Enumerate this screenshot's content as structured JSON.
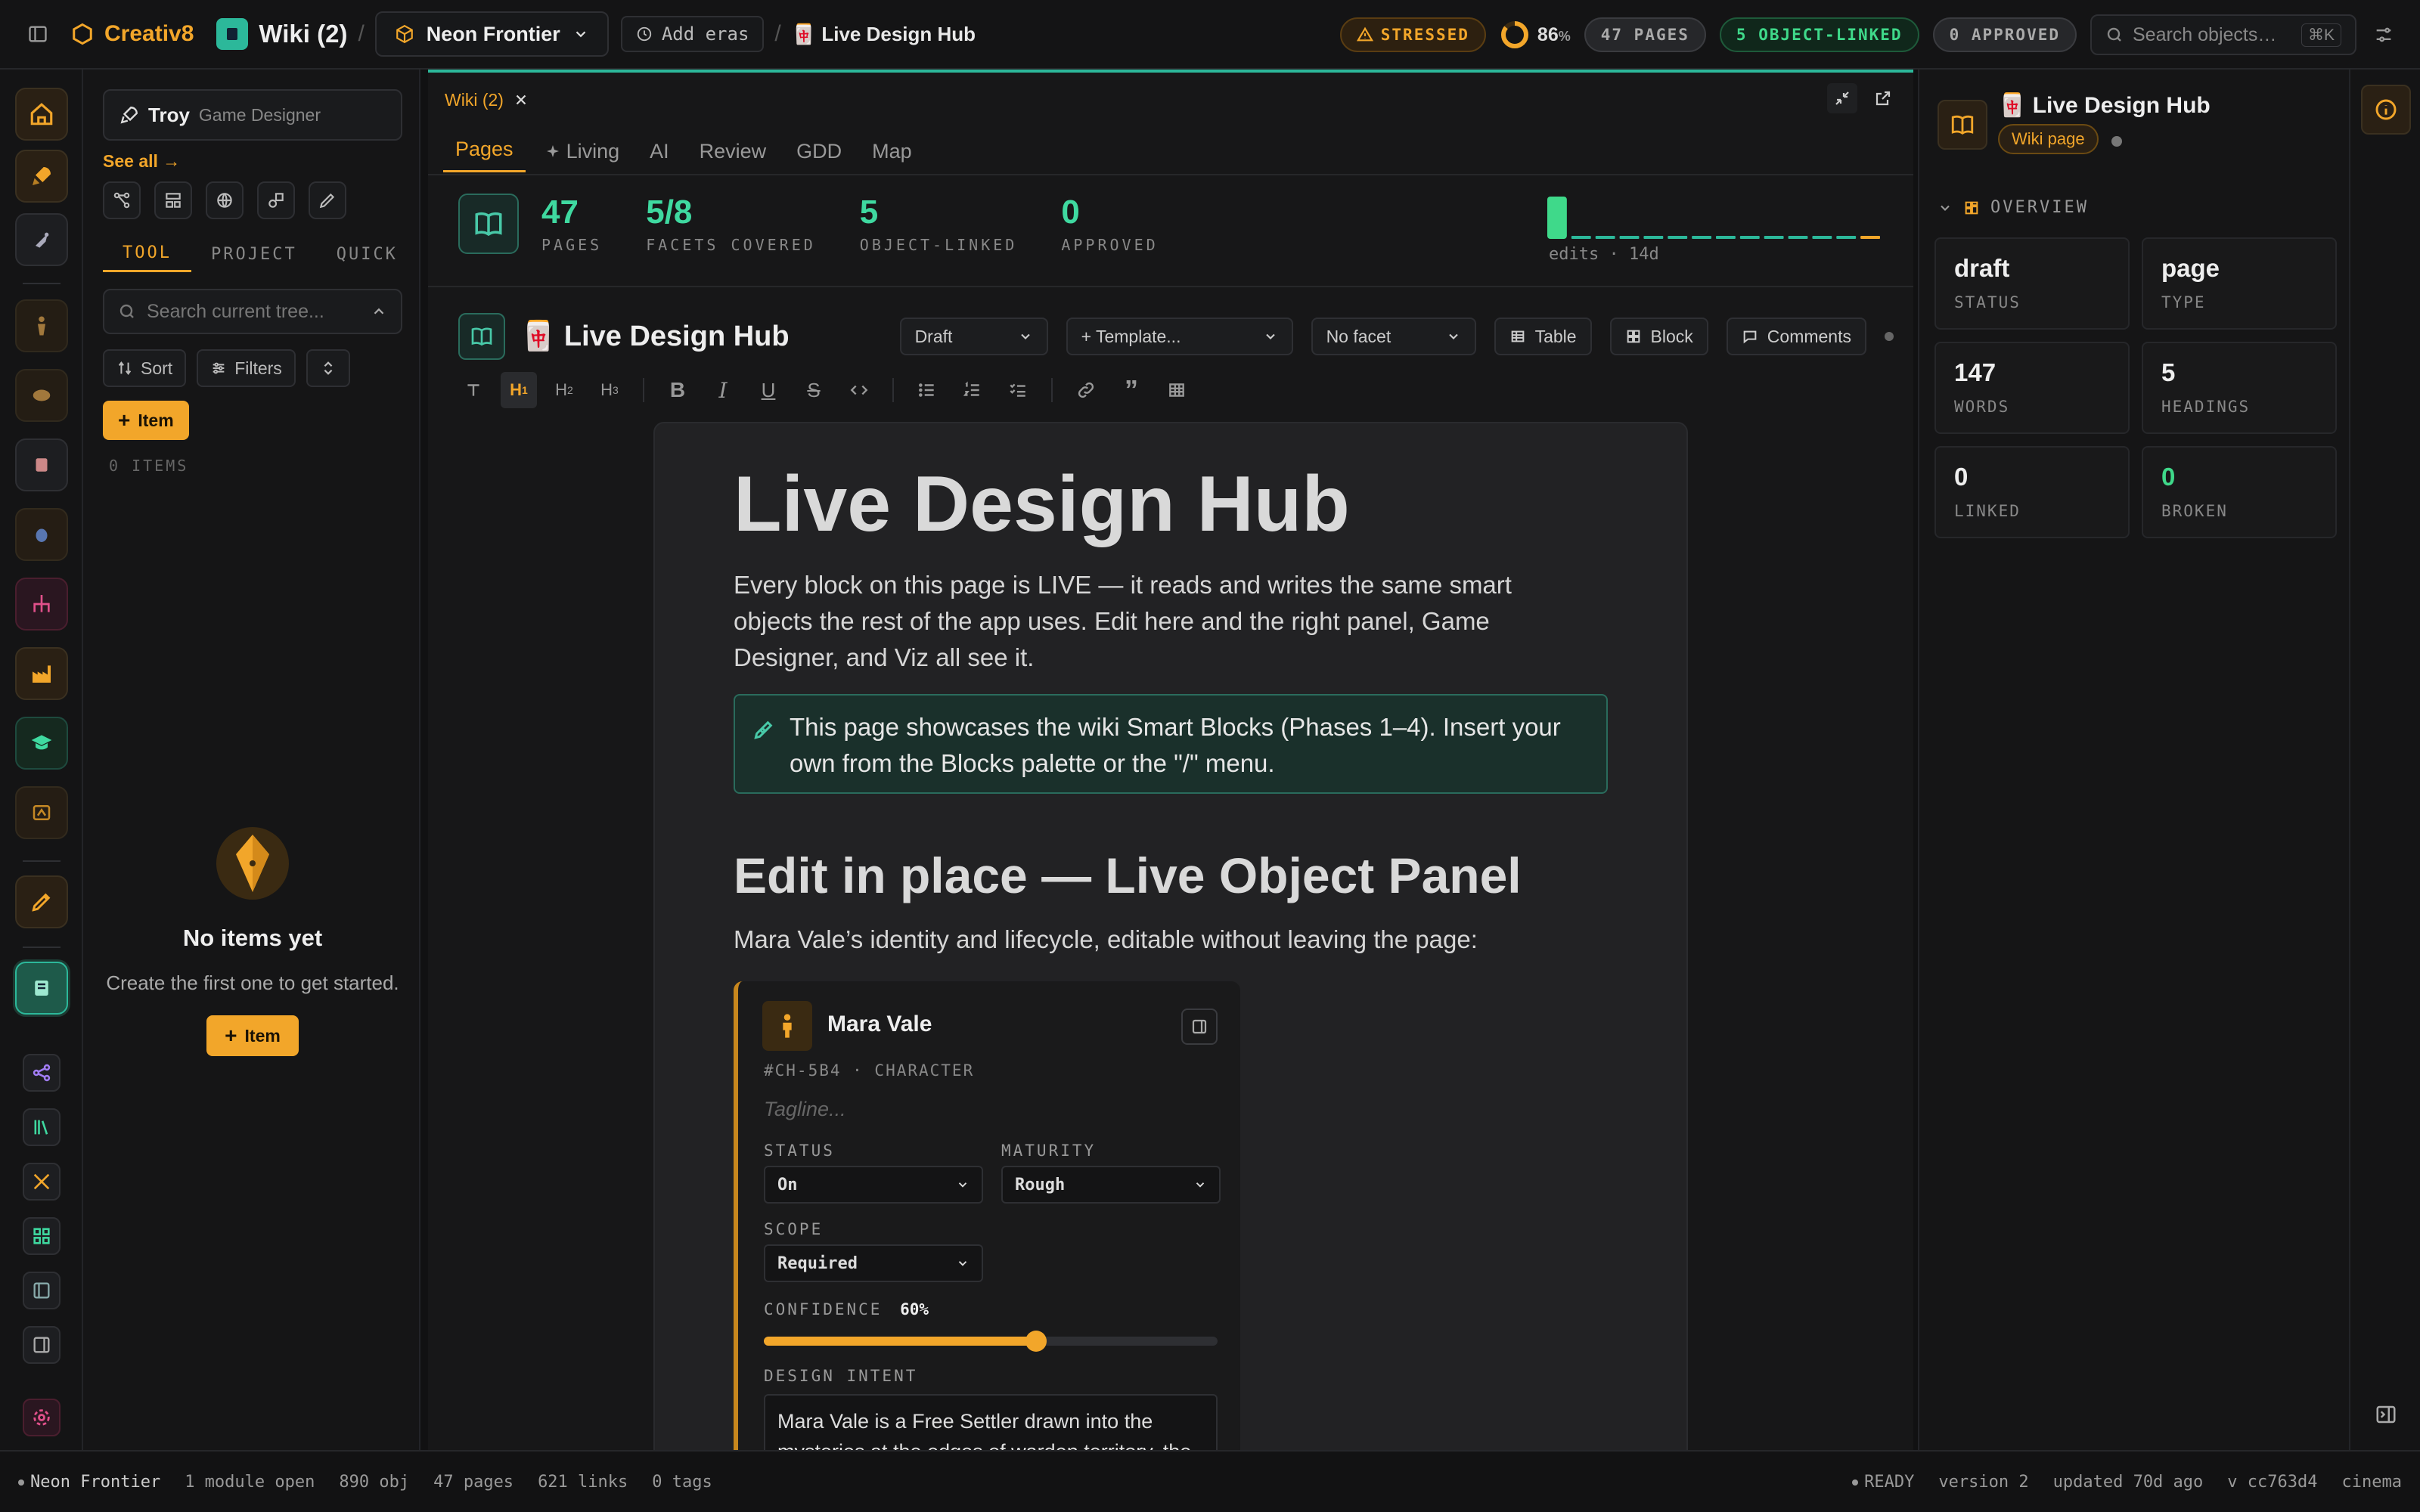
{
  "topbar": {
    "brand": "Creativ8",
    "module_title": "Wiki (2)",
    "project_label": "Neon Frontier",
    "add_eras": "Add eras",
    "crumb_title": "🀄 Live Design Hub",
    "stressed": "STRESSED",
    "ring_value": "86",
    "ring_unit": "%",
    "pages_pill": "47 PAGES",
    "linked_pill": "5 OBJECT-LINKED",
    "approved_pill": "0 APPROVED",
    "search_placeholder": "Search objects…",
    "search_shortcut": "⌘K"
  },
  "sidebar": {
    "user_name": "Troy",
    "user_role": "Game Designer",
    "see_all": "See all →",
    "tabs": [
      "TOOL",
      "PROJECT",
      "QUICK"
    ],
    "search_placeholder": "Search current tree...",
    "sort": "Sort",
    "filters": "Filters",
    "item_button": "Item",
    "items_count": "0 ITEMS",
    "empty_title": "No items yet",
    "empty_sub": "Create the first one to get started.",
    "empty_button": "Item"
  },
  "main": {
    "tab_label": "Wiki (2)",
    "nav_tabs": [
      "Pages",
      "Living",
      "AI",
      "Review",
      "GDD",
      "Map"
    ],
    "stats": [
      {
        "value": "47",
        "label": "PAGES"
      },
      {
        "value": "5/8",
        "label": "FACETS COVERED"
      },
      {
        "value": "5",
        "label": "OBJECT-LINKED"
      },
      {
        "value": "0",
        "label": "APPROVED"
      }
    ],
    "spark_caption": "edits · 14d",
    "doc_title": "🀄 Live Design Hub",
    "status_select": "Draft",
    "template_select": "+ Template...",
    "facet_select": "No facet",
    "table_btn": "Table",
    "block_btn": "Block",
    "comments_btn": "Comments",
    "page": {
      "h1": "Live Design Hub",
      "lead": "Every block on this page is LIVE — it reads and writes the same smart objects the rest of the app uses. Edit here and the right panel, Game Designer, and Viz all see it.",
      "callout": "This page showcases the wiki Smart Blocks (Phases 1–4). Insert your own from the Blocks palette or the \"/\" menu.",
      "h2": "Edit in place — Live Object Panel",
      "sub": "Mara Vale’s identity and lifecycle, editable without leaving the page:",
      "object": {
        "name": "Mara Vale",
        "id_line": "#CH-5B4 · CHARACTER",
        "tagline_placeholder": "Tagline...",
        "status_label": "STATUS",
        "status_value": "On",
        "maturity_label": "MATURITY",
        "maturity_value": "Rough",
        "scope_label": "SCOPE",
        "scope_value": "Required",
        "confidence_label": "CONFIDENCE",
        "confidence_value": "60%",
        "confidence": 0.6,
        "intent_label": "DESIGN INTENT",
        "intent_text": "Mara Vale is a Free Settler drawn into the mysteries at the edges of warden territory, the"
      }
    }
  },
  "right_panel": {
    "title": "🀄 Live Design Hub",
    "badge": "Wiki page",
    "section": "OVERVIEW",
    "cards": [
      {
        "value": "draft",
        "label": "STATUS"
      },
      {
        "value": "page",
        "label": "TYPE"
      },
      {
        "value": "147",
        "label": "WORDS"
      },
      {
        "value": "5",
        "label": "HEADINGS"
      },
      {
        "value": "0",
        "label": "LINKED"
      },
      {
        "value": "0",
        "label": "BROKEN"
      }
    ]
  },
  "statusbar": {
    "project": "Neon Frontier",
    "modules": "1 module open",
    "objects": "890 obj",
    "pages": "47 pages",
    "links": "621 links",
    "tags": "0 tags",
    "ready": "READY",
    "version": "version 2",
    "updated": "updated 70d ago",
    "build": "v cc763d4",
    "mode": "cinema"
  },
  "colors": {
    "accent": "#f2a62a",
    "teal": "#48c9a8",
    "green": "#3fd98a",
    "bg": "#111112"
  },
  "sparkline": [
    1,
    0,
    0,
    0,
    0,
    0,
    0,
    0,
    0,
    0,
    0,
    0,
    0,
    0
  ]
}
